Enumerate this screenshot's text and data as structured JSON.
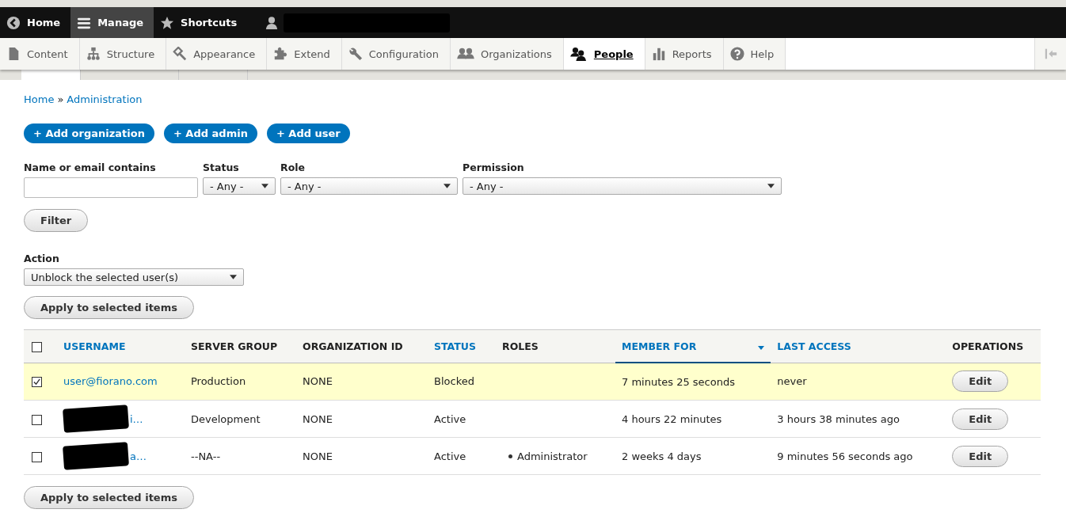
{
  "toolbar": {
    "items": [
      {
        "label": "Home",
        "selected": false
      },
      {
        "label": "Manage",
        "selected": true
      },
      {
        "label": "Shortcuts",
        "selected": false
      }
    ]
  },
  "tray": {
    "items": [
      {
        "label": "Content",
        "selected": false
      },
      {
        "label": "Structure",
        "selected": false
      },
      {
        "label": "Appearance",
        "selected": false
      },
      {
        "label": "Extend",
        "selected": false
      },
      {
        "label": "Configuration",
        "selected": false
      },
      {
        "label": "Organizations",
        "selected": false
      },
      {
        "label": "People",
        "selected": true
      },
      {
        "label": "Reports",
        "selected": false
      },
      {
        "label": "Help",
        "selected": false
      }
    ]
  },
  "secondary_tabs": [
    {
      "selected": true
    },
    {
      "selected": false
    },
    {
      "selected": false
    }
  ],
  "breadcrumb": [
    "Home",
    "Administration"
  ],
  "breadcrumb_separator": "»",
  "action_links": [
    "+ Add organization",
    "+ Add admin",
    "+ Add user"
  ],
  "filters": [
    {
      "label": "Name or email contains",
      "kind": "text"
    },
    {
      "label": "Status",
      "kind": "select",
      "value": "- Any -"
    },
    {
      "label": "Role",
      "kind": "select",
      "value": "- Any -"
    },
    {
      "label": "Permission",
      "kind": "select",
      "value": "- Any -"
    }
  ],
  "filter_button": "Filter",
  "action": {
    "label": "Action",
    "value": "Unblock the selected user(s)"
  },
  "apply_button_top": "Apply to selected items",
  "table": {
    "columns": [
      {
        "label": "USERNAME",
        "sortable": true,
        "active": false
      },
      {
        "label": "SERVER GROUP",
        "sortable": false,
        "active": false
      },
      {
        "label": "ORGANIZATION ID",
        "sortable": false,
        "active": false
      },
      {
        "label": "STATUS",
        "sortable": true,
        "active": false
      },
      {
        "label": "ROLES",
        "sortable": false,
        "active": false
      },
      {
        "label": "MEMBER FOR",
        "sortable": true,
        "active": true
      },
      {
        "label": "LAST ACCESS",
        "sortable": true,
        "active": false
      },
      {
        "label": "OPERATIONS",
        "sortable": false,
        "active": false
      }
    ],
    "all_checked": false,
    "rows": [
      {
        "checked": true,
        "username": "user@fiorano.com",
        "redacted": false,
        "server_group": "Production",
        "organization_id": "NONE",
        "status": "Blocked",
        "roles": [],
        "member_for": "7 minutes 25 seconds",
        "last_access": "never",
        "operation": "Edit"
      },
      {
        "checked": false,
        "username": "i…",
        "redacted": true,
        "server_group": "Development",
        "organization_id": "NONE",
        "status": "Active",
        "roles": [],
        "member_for": "4 hours 22 minutes",
        "last_access": "3 hours 38 minutes ago",
        "operation": "Edit"
      },
      {
        "checked": false,
        "username": "a…",
        "redacted": true,
        "server_group": "--NA--",
        "organization_id": "NONE",
        "status": "Active",
        "roles": [
          "Administrator"
        ],
        "member_for": "2 weeks 4 days",
        "last_access": "9 minutes 56 seconds ago",
        "operation": "Edit"
      }
    ]
  },
  "apply_button_bottom": "Apply to selected items"
}
